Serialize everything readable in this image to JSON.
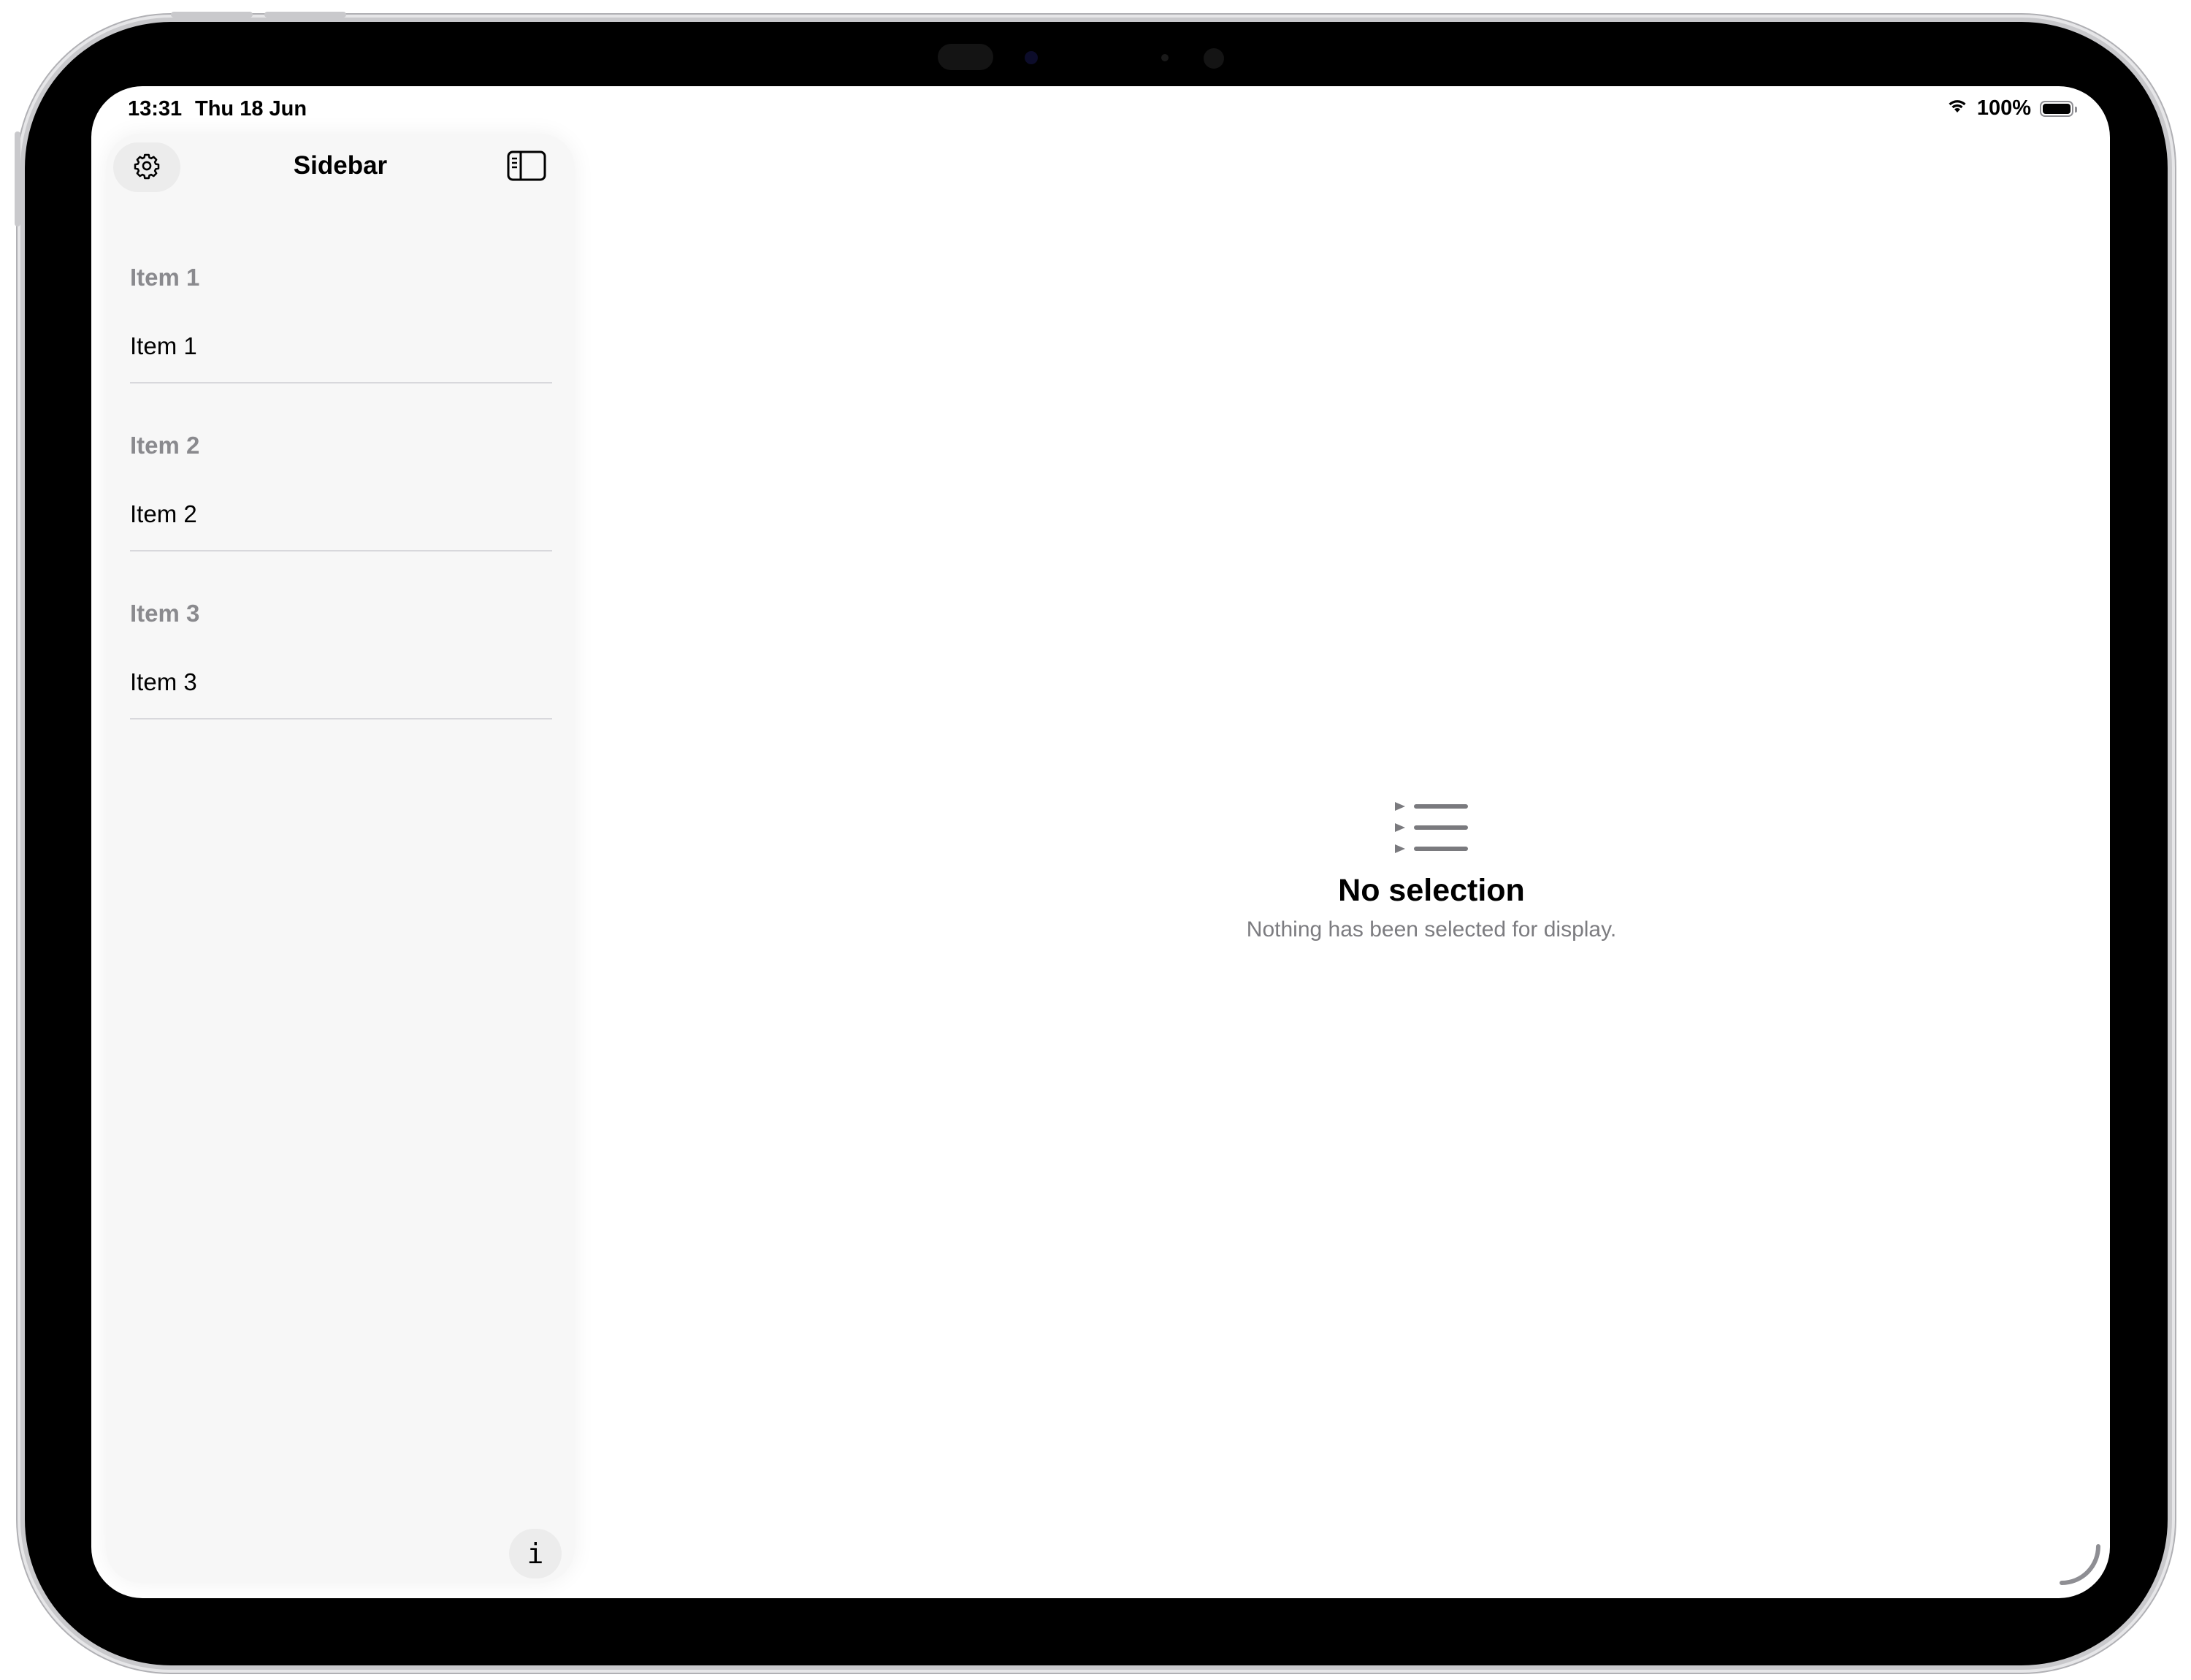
{
  "status_bar": {
    "time": "13:31",
    "date": "Thu 18 Jun",
    "battery_percent_label": "100%",
    "battery_level": 1.0
  },
  "sidebar": {
    "title": "Sidebar",
    "sections": [
      {
        "header": "Item 1",
        "row": "Item 1"
      },
      {
        "header": "Item 2",
        "row": "Item 2"
      },
      {
        "header": "Item 3",
        "row": "Item 3"
      }
    ],
    "info_label": "i"
  },
  "main": {
    "empty_title": "No selection",
    "empty_subtitle": "Nothing has been selected for display."
  },
  "icons": {
    "settings": "gear-icon",
    "toggle_sidebar": "sidebar-left-icon",
    "empty_state": "list-bullet-indent-icon",
    "wifi": "wifi-icon",
    "battery": "battery-icon"
  },
  "colors": {
    "sidebar_background": "#f7f7f7",
    "section_header": "#8a8a8e",
    "subtitle": "#7c7c80",
    "icon_gray": "#7a7a7e"
  }
}
